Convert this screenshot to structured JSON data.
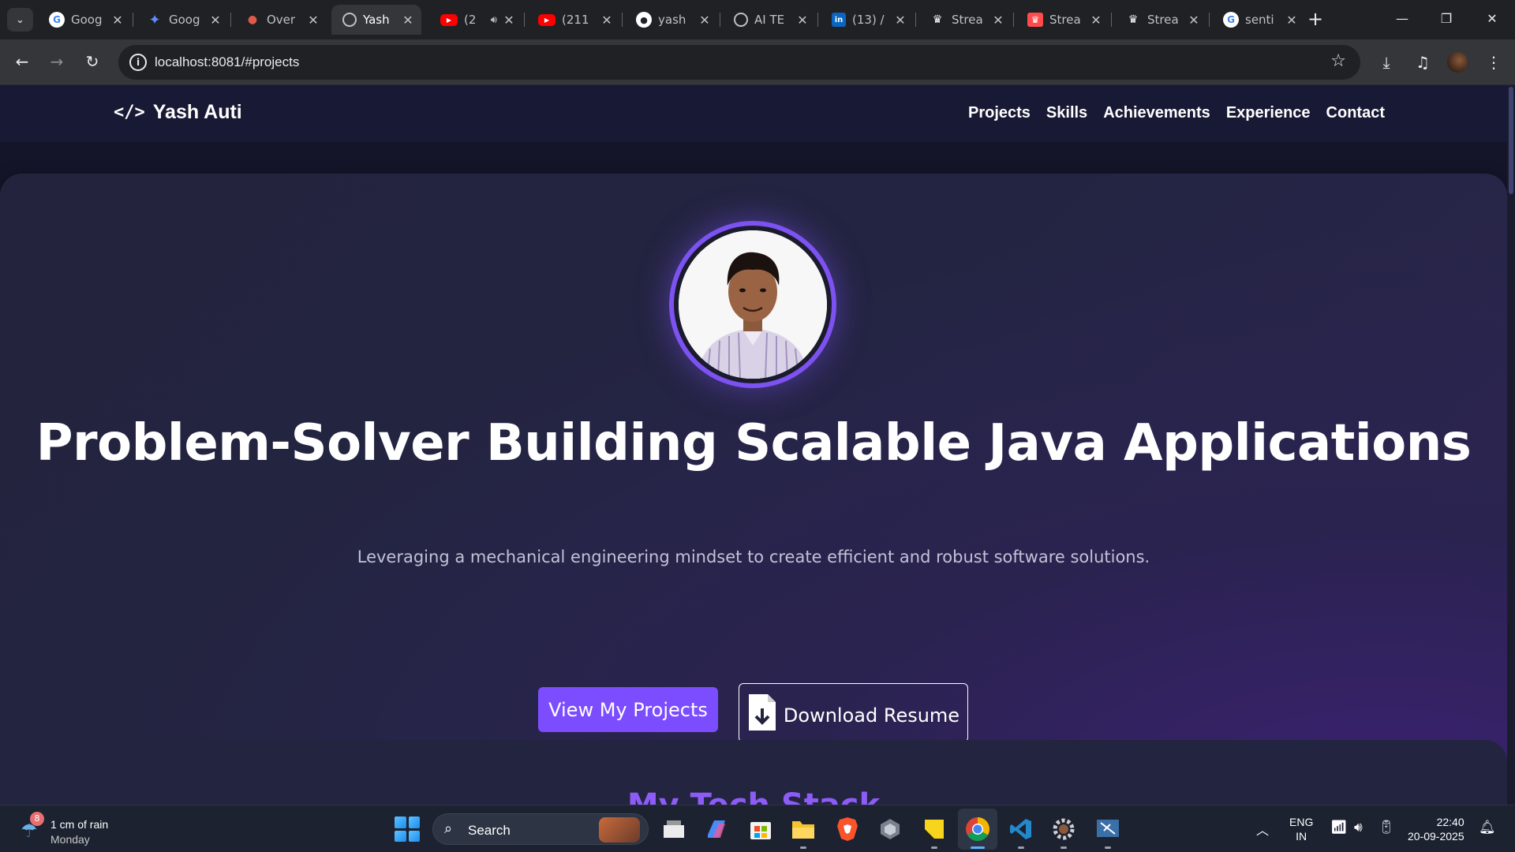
{
  "browser": {
    "tabs": [
      {
        "title": "Goog",
        "favicon": "google-icon",
        "active": false
      },
      {
        "title": "Goog",
        "favicon": "gemini-icon",
        "active": false
      },
      {
        "title": "Over",
        "favicon": "octopus-icon",
        "active": false
      },
      {
        "title": "Yash",
        "favicon": "globe-icon",
        "active": true
      },
      {
        "title": "(2",
        "favicon": "youtube-icon",
        "active": false,
        "audio": true
      },
      {
        "title": "(211",
        "favicon": "youtube-icon",
        "active": false
      },
      {
        "title": "yash",
        "favicon": "github-icon",
        "active": false
      },
      {
        "title": "AI TE",
        "favicon": "globe-icon",
        "active": false
      },
      {
        "title": "(13) /",
        "favicon": "linkedin-icon",
        "active": false
      },
      {
        "title": "Strea",
        "favicon": "streamlit-icon",
        "active": false
      },
      {
        "title": "Strea",
        "favicon": "streamlit-icon",
        "active": false
      },
      {
        "title": "Strea",
        "favicon": "streamlit-icon",
        "active": false
      },
      {
        "title": "senti",
        "favicon": "google-icon",
        "active": false
      }
    ],
    "url": "localhost:8081/#projects"
  },
  "site": {
    "brand": "Yash Auti",
    "brand_icon": "</>",
    "nav": [
      "Projects",
      "Skills",
      "Achievements",
      "Experience",
      "Contact"
    ],
    "hero": {
      "title": "Problem-Solver Building Scalable Java Applications",
      "subtitle": "Leveraging a mechanical engineering mindset to create efficient and robust software solutions.",
      "primary_button": "View My Projects",
      "secondary_button": "Download Resume"
    },
    "next_section_title": "My Tech Stack"
  },
  "taskbar": {
    "weather_badge": "8",
    "weather_line1": "1 cm of rain",
    "weather_line2": "Monday",
    "search_label": "Search",
    "lang_line1": "ENG",
    "lang_line2": "IN",
    "time": "22:40",
    "date": "20-09-2025"
  },
  "colors": {
    "accent": "#7c4dff",
    "avatar_ring": "#7c52f0",
    "page_bg": "#15152a",
    "section_title": "#8d5cf6"
  }
}
